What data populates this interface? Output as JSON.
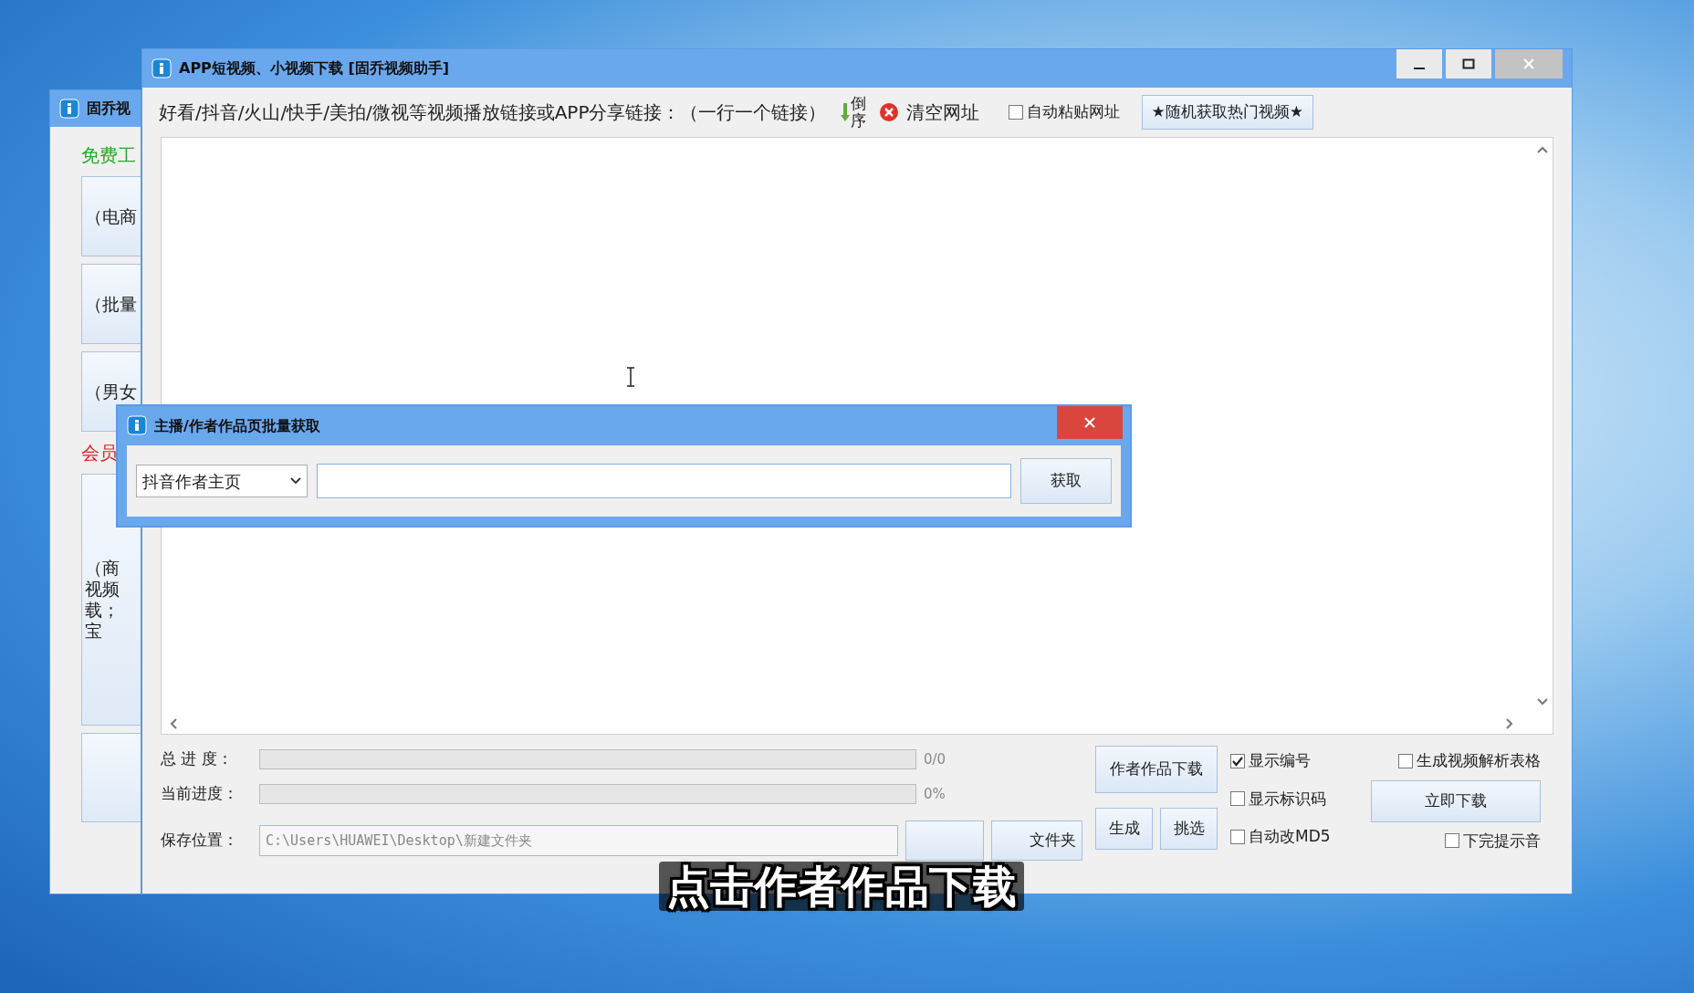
{
  "background_window": {
    "title": "固乔视",
    "items": [
      {
        "kind": "heading",
        "text": "免费工",
        "color": "#22aa22"
      },
      {
        "kind": "button",
        "lines": [
          "（电商"
        ]
      },
      {
        "kind": "button",
        "lines": [
          "（批量"
        ]
      },
      {
        "kind": "button",
        "lines": [
          "（男女"
        ]
      },
      {
        "kind": "heading",
        "text": "会员",
        "color": "#e02020"
      },
      {
        "kind": "tall",
        "lines": [
          "（商",
          "视频",
          "载；",
          "宝"
        ]
      },
      {
        "kind": "button"
      }
    ]
  },
  "main_window": {
    "title": "APP短视频、小视频下载 [固乔视频助手]",
    "toolbar": {
      "prompt": "好看/抖音/火山/快手/美拍/微视等视频播放链接或APP分享链接：（一行一个链接）",
      "reverse": "倒序",
      "clear": "清空网址",
      "auto_paste": {
        "label": "自动粘贴网址",
        "checked": false
      },
      "random_button": "★随机获取热门视频★"
    },
    "progress": [
      {
        "label": "总 进 度：",
        "level": 0,
        "reading": "0/0"
      },
      {
        "label": "当前进度：",
        "level": 0,
        "reading": "0%"
      }
    ],
    "save": {
      "label": "保存位置：",
      "value": "C:\\Users\\HUAWEI\\Desktop\\新建文件夹",
      "buttons": [
        {
          "kind": "covered"
        },
        {
          "kind": "text",
          "label": "文件夹"
        }
      ]
    },
    "author_button": "作者作品下载",
    "generate_button": "生成",
    "pick_button": "挑选",
    "options": [
      {
        "label": "显示编号",
        "checked": true
      },
      {
        "label": "显示标识码",
        "checked": false
      },
      {
        "label": "自动改MD5",
        "checked": false
      }
    ],
    "table_option": {
      "label": "生成视频解析表格",
      "checked": false
    },
    "download_button": "立即下载",
    "sound_option": {
      "label": "下完提示音",
      "checked": false
    }
  },
  "dialog": {
    "title": "主播/作者作品页批量获取",
    "dropdown": "抖音作者主页",
    "fetch_button": "获取"
  },
  "subtitle": "点击作者作品下载"
}
